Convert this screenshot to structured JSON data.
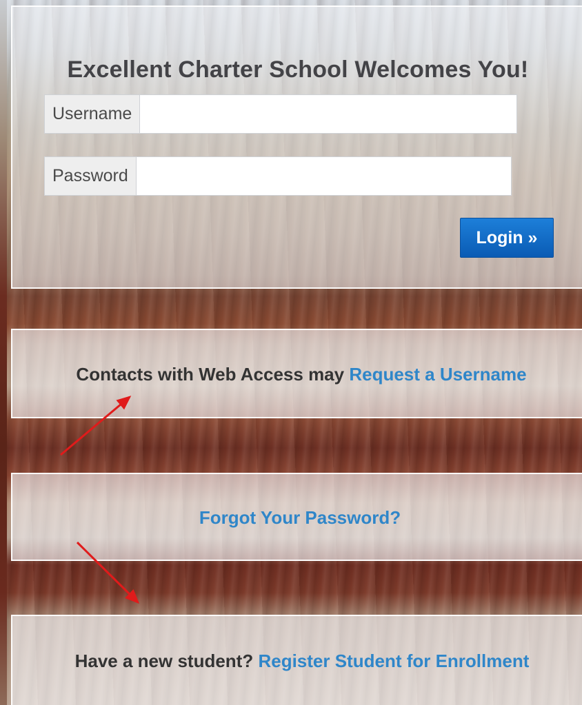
{
  "login": {
    "title": "Excellent Charter School Welcomes You!",
    "username_label": "Username",
    "username_value": "",
    "password_label": "Password",
    "password_value": "",
    "login_button": "Login »"
  },
  "contacts": {
    "text": "Contacts with Web Access may ",
    "link": "Request a Username"
  },
  "forgot": {
    "link": "Forgot Your Password?"
  },
  "register": {
    "text": "Have a new student? ",
    "link": "Register Student for Enrollment"
  },
  "colors": {
    "link": "#2f86c9",
    "button": "#0a5bb4",
    "arrow": "#e01b1b"
  }
}
